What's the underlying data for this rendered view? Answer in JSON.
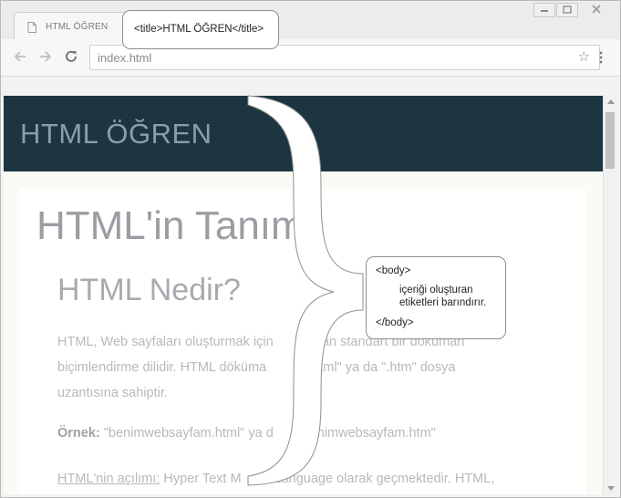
{
  "browser": {
    "tab_title": "HTML ÖĞREN",
    "address": "index.html"
  },
  "page": {
    "header_title": "HTML ÖĞREN",
    "heading1": "HTML'in Tanım",
    "heading2": "HTML Nedir?",
    "para1_line1": "HTML, Web sayfaları oluşturmak için",
    "para1_line1_tail": "nılan standart bir doküman",
    "para1_line2": "biçimlendirme dilidir. HTML döküma",
    "para1_line2_tail": ".html\" ya da \".htm\" dosya",
    "para1_line3": "uzantısına sahiptir.",
    "ornek_label": "Örnek:",
    "ornek_text": " \"benimwebsayfam.html\" ya d",
    "ornek_tail": "nimwebsayfam.htm\"",
    "acilim_label": "HTML'nin açılımı:",
    "acilim_text": " Hyper Text M",
    "acilim_tail": "Language olarak geçmektedir. HTML,"
  },
  "callouts": {
    "title_tag": "<title>HTML ÖĞREN</title>",
    "body_open": "<body>",
    "body_desc_line1": "içeriği oluşturan",
    "body_desc_line2": "etiketleri barındırır.",
    "body_close": "</body>"
  },
  "icons": [
    "page-icon",
    "back-arrow-icon",
    "forward-arrow-icon",
    "reload-icon",
    "star-icon",
    "menu-dots-icon",
    "minimize-icon",
    "maximize-icon",
    "close-icon"
  ]
}
